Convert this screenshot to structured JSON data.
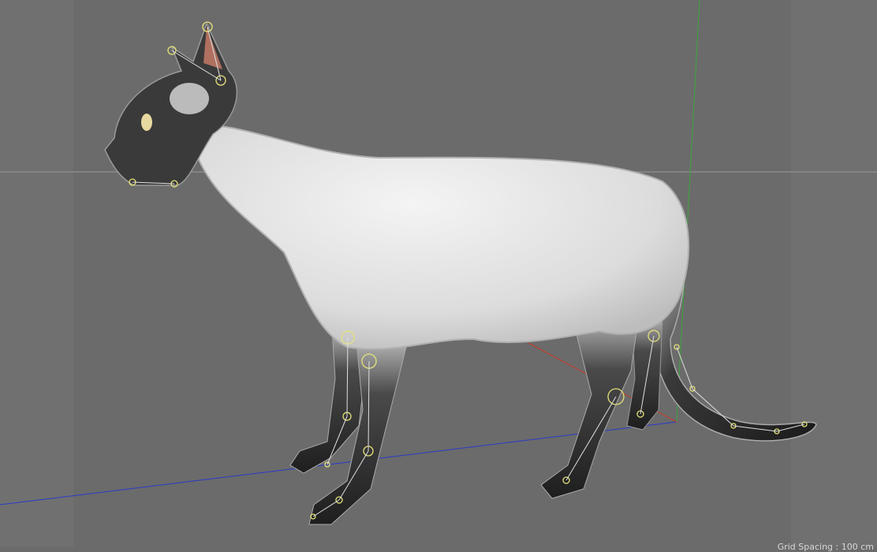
{
  "viewport": {
    "background_color": "#6b6b6b",
    "grid_spacing_label": "Grid Spacing : 100 cm",
    "axis_colors": {
      "x": "#c83a2a",
      "y": "#3aa83a",
      "z": "#2a3ac8"
    },
    "joint_color": "#e6e37a",
    "model": "siamese-cat-rig"
  }
}
